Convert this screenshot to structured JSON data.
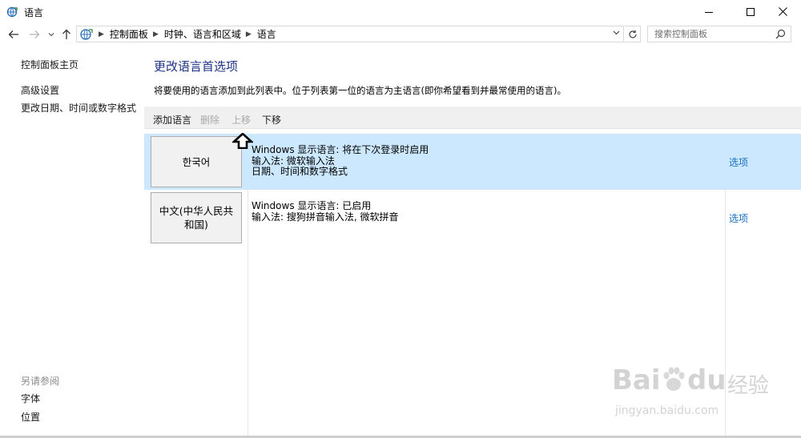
{
  "window": {
    "title": "语言",
    "icon": "language-globe-icon",
    "controls": [
      "minimize-icon",
      "maximize-icon",
      "close-icon"
    ]
  },
  "address_bar": {
    "breadcrumb": [
      "控制面板",
      "时钟、语言和区域",
      "语言"
    ],
    "search_placeholder": "搜索控制面板"
  },
  "sidebar": {
    "home": "控制面板主页",
    "links": [
      "高级设置",
      "更改日期、时间或数字格式"
    ],
    "see_also_title": "另请参阅",
    "see_also": [
      "字体",
      "位置"
    ]
  },
  "main": {
    "title": "更改语言首选项",
    "description": "将要使用的语言添加到此列表中。位于列表第一位的语言为主语言(即你希望看到并最常使用的语言)。",
    "toolbar": {
      "add": "添加语言",
      "remove": "删除",
      "move_up": "上移",
      "move_down": "下移"
    },
    "languages": [
      {
        "name": "한국어",
        "selected": true,
        "info": [
          "Windows 显示语言: 将在下次登录时启用",
          "输入法: 微软输入法",
          "日期、时间和数字格式"
        ],
        "options": "选项"
      },
      {
        "name": "中文(中华人民共和国)",
        "selected": false,
        "info": [
          "Windows 显示语言: 已启用",
          "输入法: 搜狗拼音输入法, 微软拼音"
        ],
        "options": "选项"
      }
    ]
  },
  "colors": {
    "accent_title": "#1e3287",
    "link": "#1a6fc0",
    "selected_row": "#cce8ff",
    "toolbar_bg": "#f0f0f0"
  },
  "watermark": {
    "brand": "Bai",
    "brand2": "du",
    "cn": "经验",
    "url": "jingyan.baidu.com"
  }
}
